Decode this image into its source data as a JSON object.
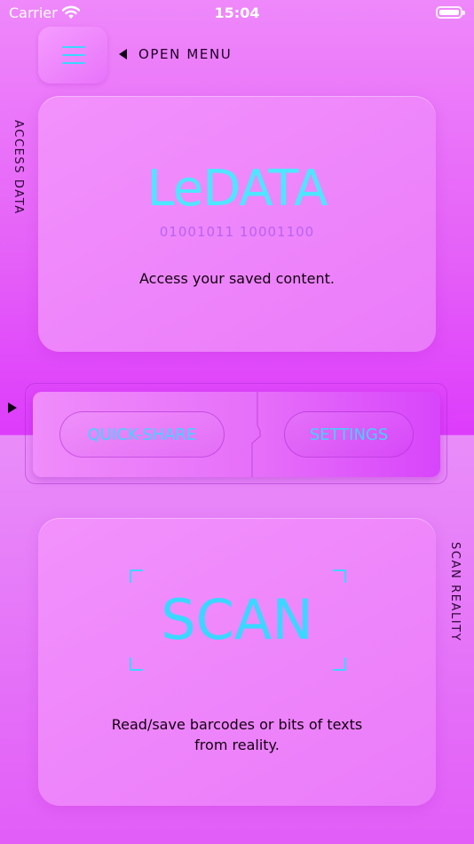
{
  "status_bar": {
    "carrier": "Carrier",
    "time": "15:04"
  },
  "header": {
    "open_menu_label": "OPEN MENU"
  },
  "side_labels": {
    "access_data": "ACCESS DATA",
    "scan_reality": "SCAN REALITY"
  },
  "data_card": {
    "title": "LeDATA",
    "binary": "01001011 10001100",
    "description": "Access your saved content."
  },
  "quick_bar": {
    "quick_share_label": "QUICK-SHARE",
    "settings_label": "SETTINGS"
  },
  "scan_card": {
    "title": "SCAN",
    "description_line1": "Read/save barcodes or bits of texts",
    "description_line2": "from reality."
  },
  "colors": {
    "accent": "#3AD7FF",
    "background": "#E561F8",
    "text": "#12020F"
  },
  "icons": [
    "wifi-icon",
    "battery-icon",
    "hamburger-icon",
    "triangle-left-icon",
    "triangle-right-icon",
    "scan-frame-corners"
  ]
}
